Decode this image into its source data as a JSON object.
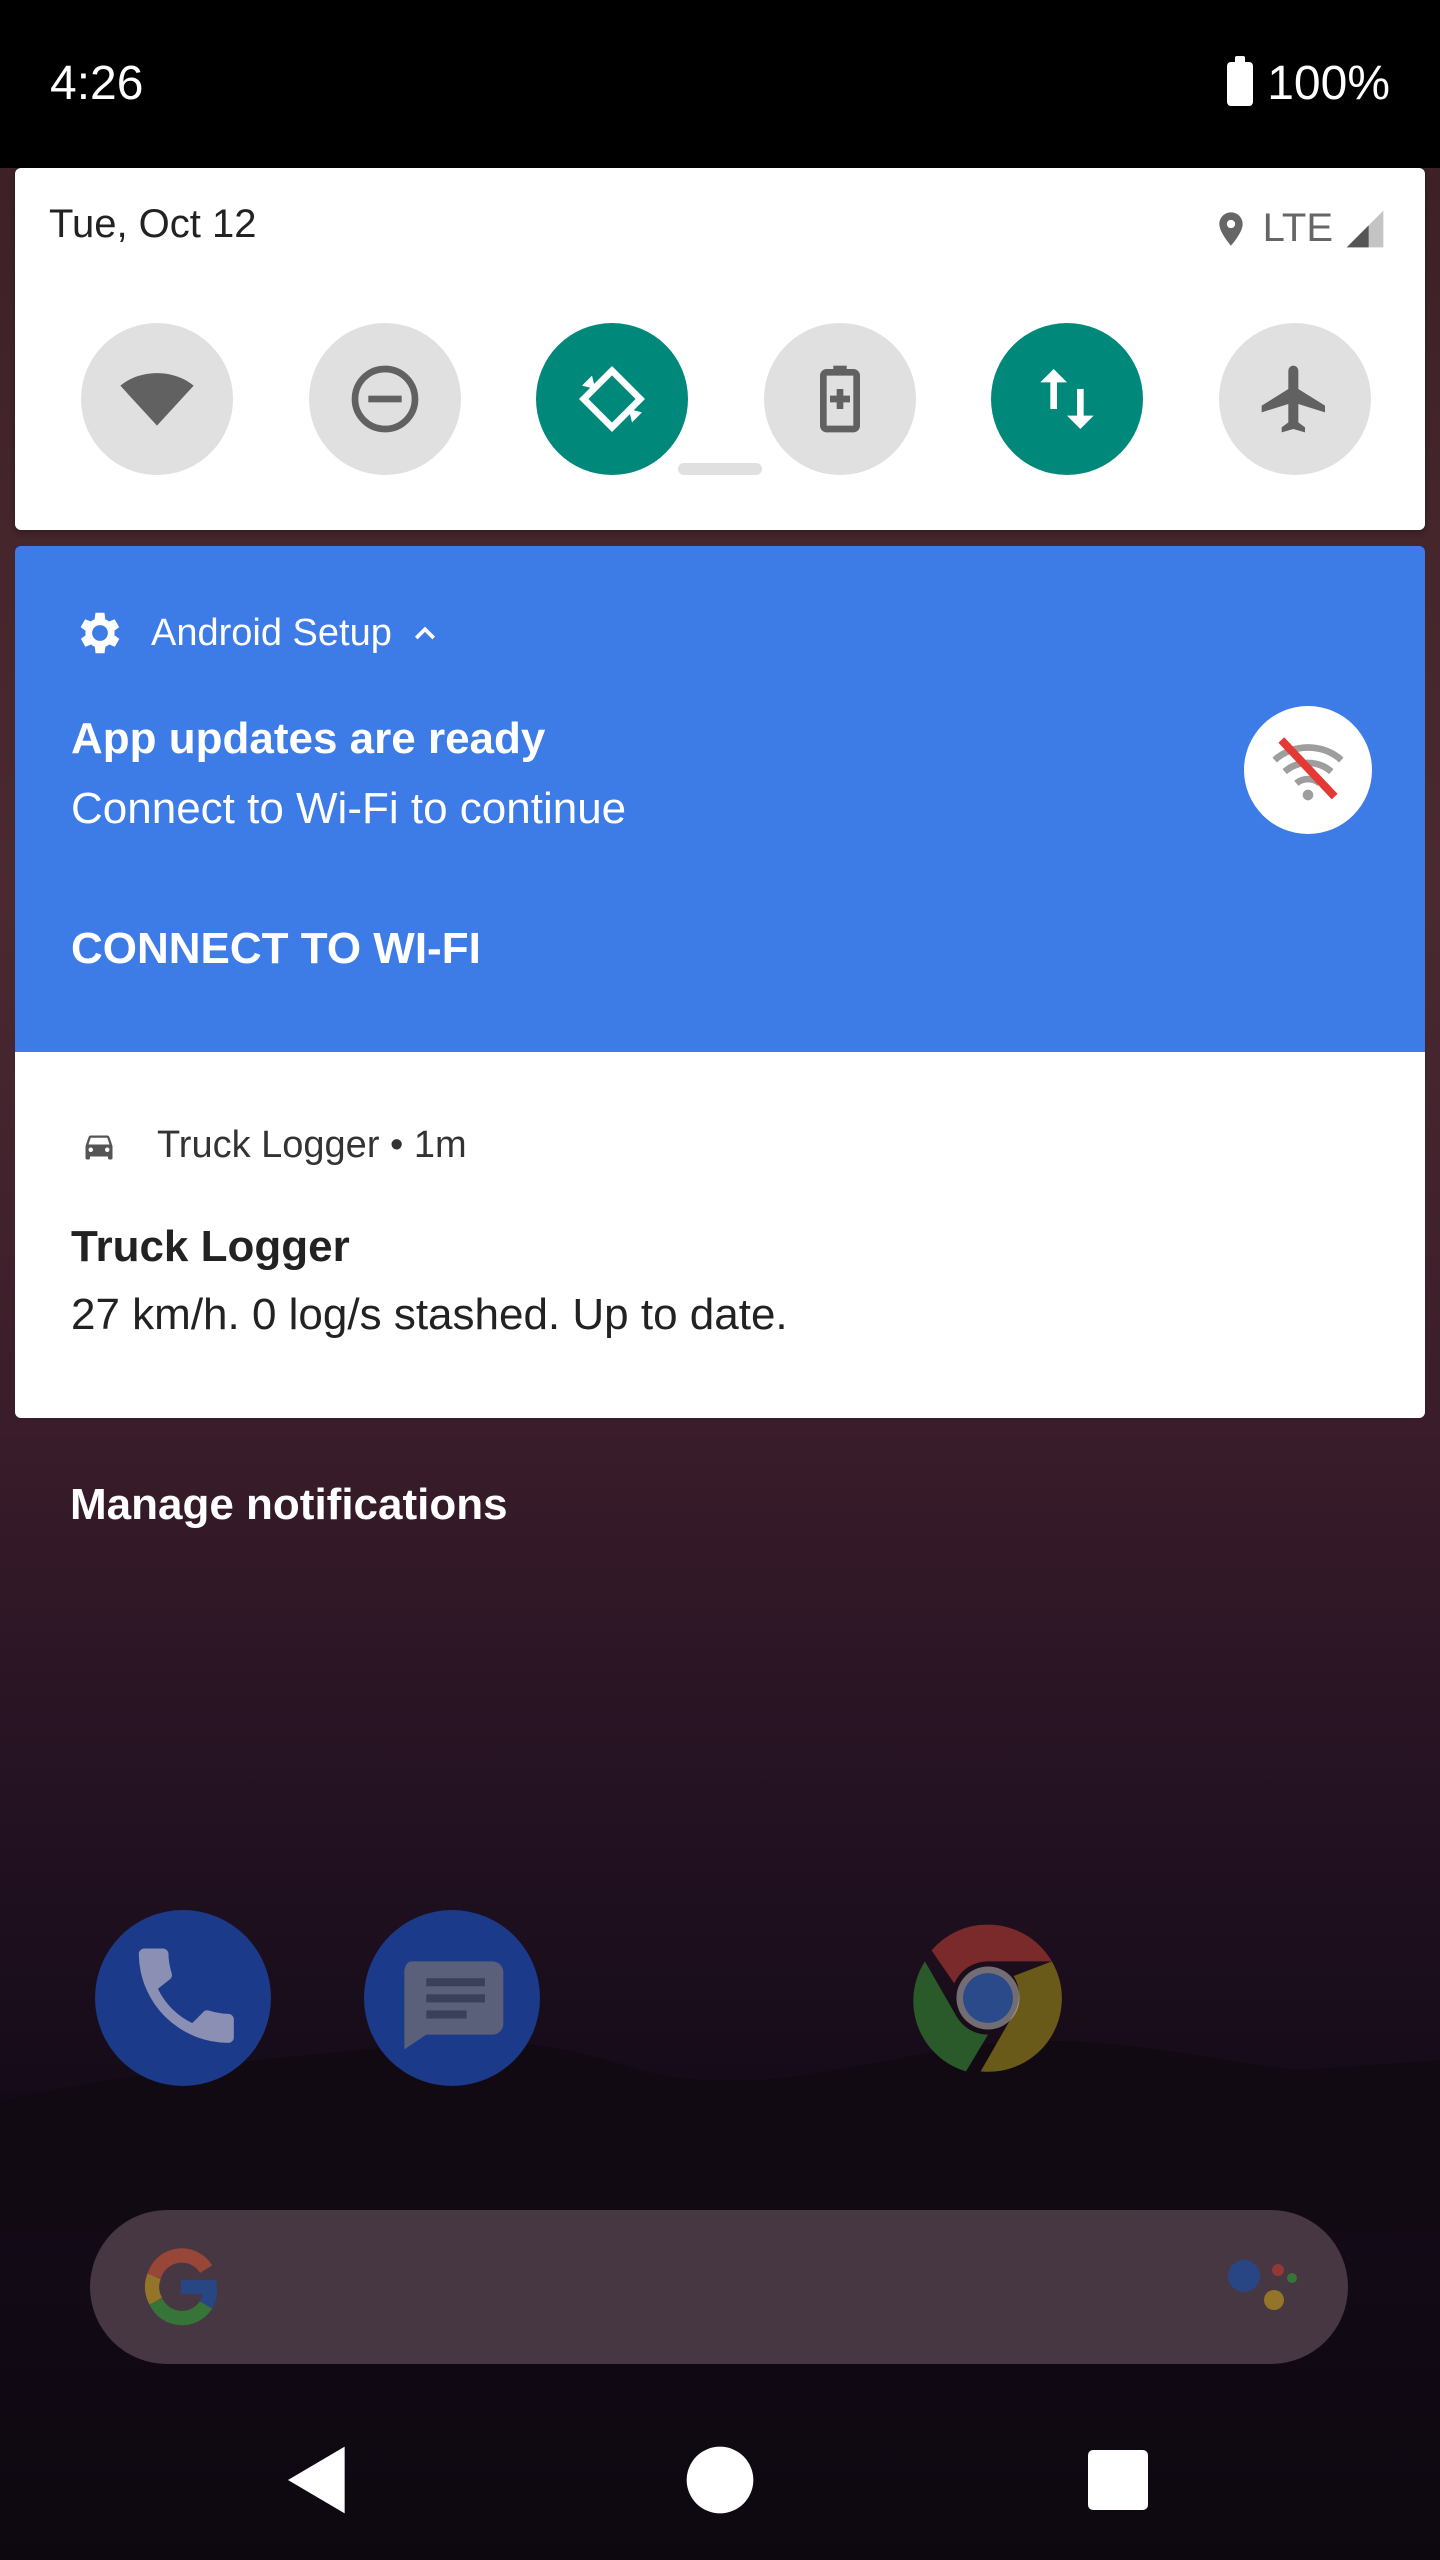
{
  "status_bar": {
    "time": "4:26",
    "battery": "100%"
  },
  "quick_settings": {
    "date": "Tue, Oct 12",
    "network": "LTE",
    "tiles": [
      {
        "name": "wifi",
        "active": false
      },
      {
        "name": "do-not-disturb",
        "active": false
      },
      {
        "name": "auto-rotate",
        "active": true
      },
      {
        "name": "battery-saver",
        "active": false
      },
      {
        "name": "mobile-data",
        "active": true
      },
      {
        "name": "airplane-mode",
        "active": false
      }
    ]
  },
  "notifications": [
    {
      "app": "Android Setup",
      "title": "App updates are ready",
      "text": "Connect to Wi-Fi to continue",
      "action": "CONNECT TO WI-FI",
      "color": "#3d7be6"
    },
    {
      "app": "Truck Logger",
      "time": "1m",
      "header": "Truck Logger • 1m",
      "title": "Truck Logger",
      "text": "27 km/h. 0 log/s stashed. Up to date."
    }
  ],
  "manage_notifications": "Manage notifications",
  "colors": {
    "accent_teal": "#00897b",
    "setup_blue": "#3d7be6"
  }
}
